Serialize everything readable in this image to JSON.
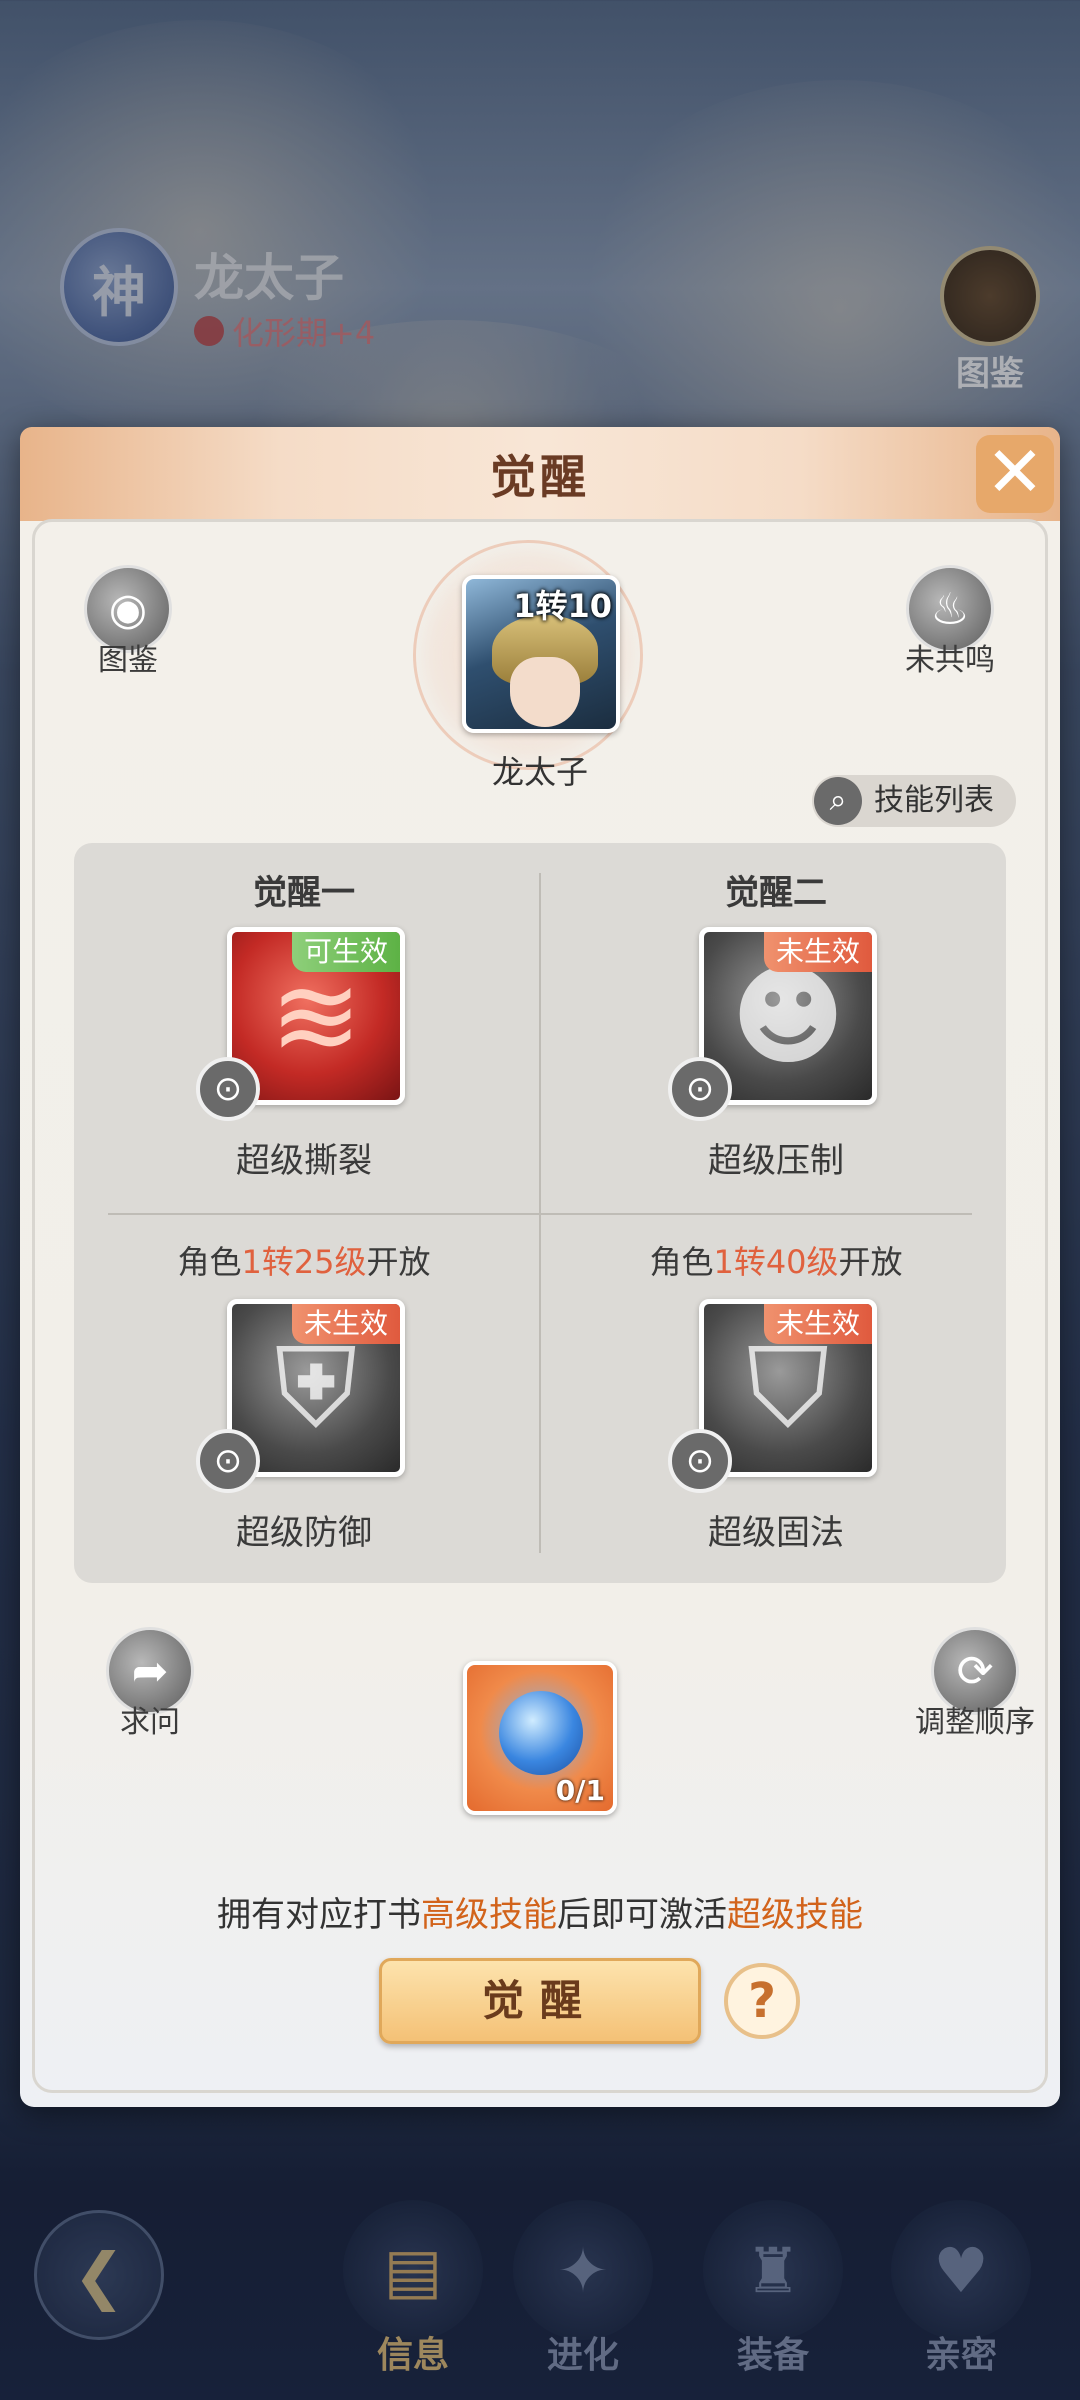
{
  "background": {
    "badge": "神",
    "hero_name": "龙太子",
    "hero_stage": "化形期+4",
    "tujian_label": "图鉴"
  },
  "nav": {
    "items": [
      {
        "label": "信息",
        "icon": "scroll-icon",
        "active": true
      },
      {
        "label": "进化",
        "icon": "sparkle-icon",
        "active": false
      },
      {
        "label": "装备",
        "icon": "armor-icon",
        "active": false
      },
      {
        "label": "亲密",
        "icon": "hearts-icon",
        "active": false
      }
    ]
  },
  "modal": {
    "title": "觉醒",
    "top_left_label": "图鉴",
    "top_right_label": "未共鸣",
    "hero": {
      "name": "龙太子",
      "rank": "1转10"
    },
    "skill_list_label": "技能列表",
    "slots": [
      {
        "title": "觉醒一",
        "skill": "超级撕裂",
        "tag": "可生效",
        "state": "active"
      },
      {
        "title": "觉醒二",
        "skill": "超级压制",
        "tag": "未生效",
        "state": "inactive"
      },
      {
        "req_prefix": "角色",
        "req_level": "1转25级",
        "req_suffix": "开放",
        "skill": "超级防御",
        "tag": "未生效",
        "state": "inactive"
      },
      {
        "req_prefix": "角色",
        "req_level": "1转40级",
        "req_suffix": "开放",
        "skill": "超级固法",
        "tag": "未生效",
        "state": "inactive"
      }
    ],
    "ask_label": "求问",
    "reorder_label": "调整顺序",
    "item_count": "0/1",
    "hint": {
      "part1": "拥有对应打书",
      "hl1": "高级技能",
      "part2": "后即可激活",
      "hl2": "超级技能"
    },
    "awaken_label": "觉醒",
    "help_label": "?"
  }
}
